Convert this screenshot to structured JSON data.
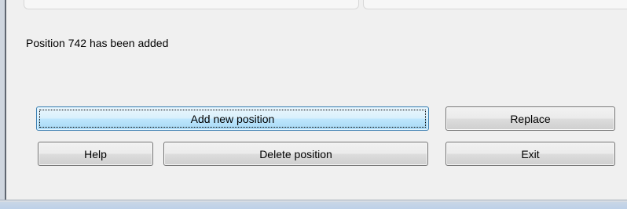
{
  "dialog": {
    "status_message": "Position 742 has been added"
  },
  "buttons": {
    "add_new_position": "Add new position",
    "replace": "Replace",
    "help": "Help",
    "delete_position": "Delete position",
    "exit": "Exit"
  },
  "colors": {
    "window_background": "#f0f0f0",
    "default_button_border": "#3c7fb1",
    "default_button_fill": "#bee6fd",
    "button_border": "#707070",
    "frame_bottom": "#bcd0e8"
  }
}
